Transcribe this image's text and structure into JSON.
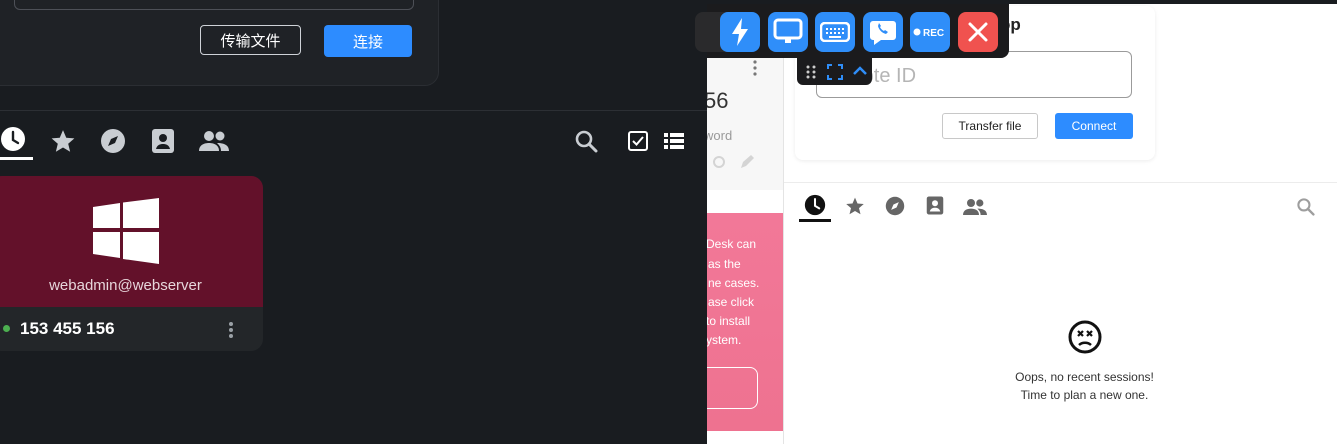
{
  "left_panel": {
    "transfer_button": "传输文件",
    "connect_button": "连接",
    "tabs": [
      "recent-sessions",
      "favorites",
      "discovered",
      "address-book",
      "group"
    ],
    "peer": {
      "name": "webadmin@webserver",
      "id": "153 455 156",
      "os": "windows",
      "status": "online"
    },
    "colors": {
      "background": "#191c20",
      "accent": "#2d8cff",
      "peer_card": "#63112a"
    }
  },
  "middle_pane": {
    "partial_id": "56",
    "partial_password_label": "word",
    "banner_lines": [
      "Desk can",
      "as the",
      "ne cases.",
      "ase click",
      "to install",
      "ystem."
    ]
  },
  "right_panel": {
    "title_fragment": "op",
    "remote_id_placeholder": "r remote ID",
    "transfer_button": "Transfer file",
    "connect_button": "Connect",
    "empty_message_line1": "Oops, no recent sessions!",
    "empty_message_line2": "Time to plan a new one.",
    "colors": {
      "background": "#ffffff",
      "accent": "#2d8cff"
    }
  },
  "toolbar": {
    "rec_label": "REC",
    "buttons": [
      "pin",
      "action-bolt",
      "display",
      "keyboard",
      "chat",
      "record",
      "close"
    ],
    "close_color": "#f0524f",
    "button_color": "#2f8ef9"
  }
}
